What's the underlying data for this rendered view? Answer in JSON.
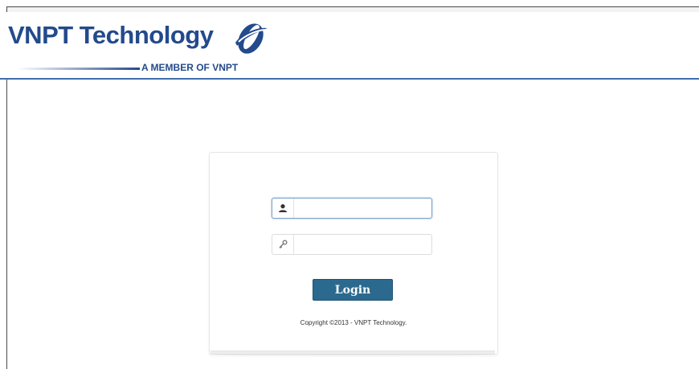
{
  "header": {
    "brand": "VNPT Technology",
    "tagline": "A MEMBER OF VNPT",
    "brand_color": "#234a8c",
    "rule_color": "#3f6eae"
  },
  "login": {
    "username": {
      "icon": "user-icon",
      "value": "",
      "placeholder": ""
    },
    "password": {
      "icon": "key-icon",
      "value": "",
      "placeholder": ""
    },
    "button_label": "Login",
    "button_color": "#2b6a8e",
    "copyright": "Copyright ©2013 - VNPT Technology."
  }
}
